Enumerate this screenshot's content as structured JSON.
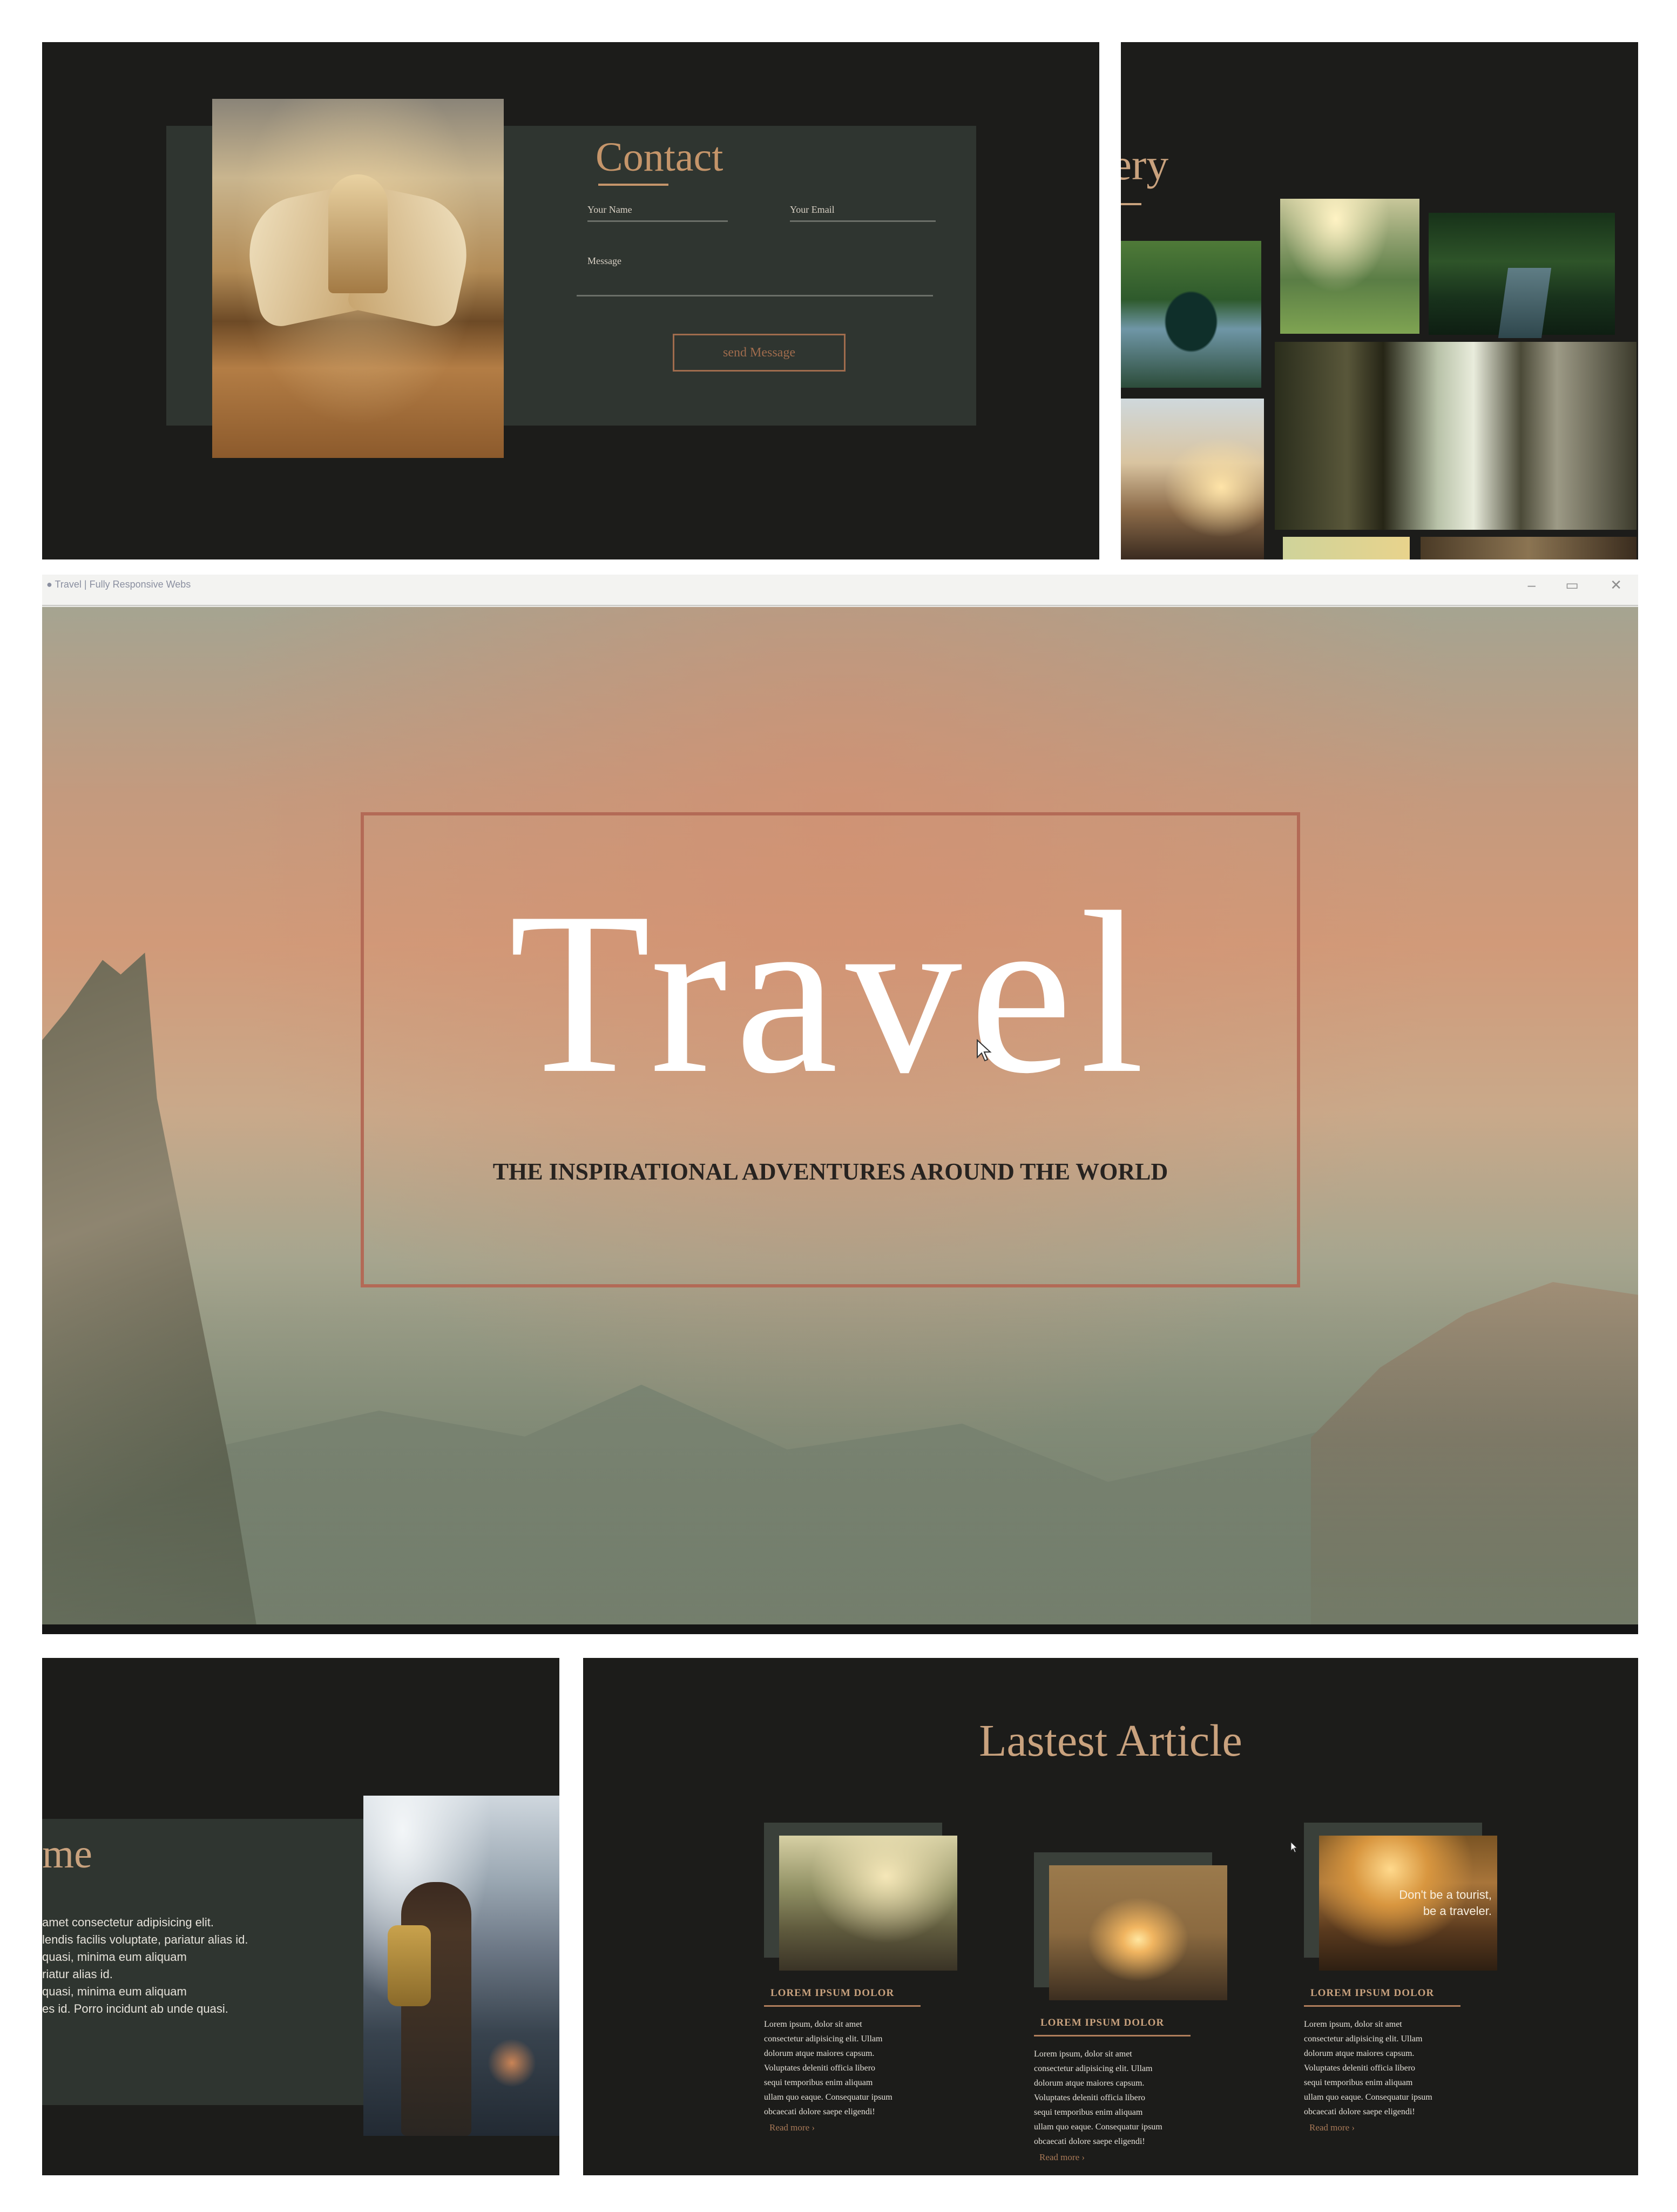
{
  "contact": {
    "title": "Contact",
    "name_label": "Your Name",
    "email_label": "Your Email",
    "message_label": "Message",
    "send_label": "send Message"
  },
  "gallery": {
    "title_fragment": "llery"
  },
  "hero": {
    "browser_tab_text": "● Travel | Fully Responsive Webs",
    "title": "Travel",
    "subtitle": "THE INSPIRATIONAL ADVENTURES AROUND THE WORLD"
  },
  "about": {
    "title_fragment": "me",
    "paragraph": "amet consectetur adipisicing elit.\nlendis facilis voluptate, pariatur alias id.\nquasi, minima eum aliquam\nriatur alias id.\nquasi, minima eum aliquam\nes id. Porro incidunt ab unde quasi."
  },
  "articles": {
    "title": "Lastest Article",
    "cards": [
      {
        "title": "LOREM IPSUM DOLOR",
        "text": "Lorem ipsum, dolor sit amet\nconsectetur adipisicing elit. Ullam\ndolorum atque maiores capsum.\nVoluptates deleniti officia libero\nsequi temporibus enim aliquam\nullam quo eaque. Consequatur ipsum\nobcaecati dolore saepe eligendi!",
        "read_more": "Read more ›"
      },
      {
        "title": "LOREM IPSUM DOLOR",
        "text": "Lorem ipsum, dolor sit amet\nconsectetur adipisicing elit. Ullam\ndolorum atque maiores capsum.\nVoluptates deleniti officia libero\nsequi temporibus enim aliquam\nullam quo eaque. Consequatur ipsum\nobcaecati dolore saepe eligendi!",
        "read_more": "Read more ›"
      },
      {
        "title": "LOREM IPSUM DOLOR",
        "text": "Lorem ipsum, dolor sit amet\nconsectetur adipisicing elit. Ullam\ndolorum atque maiores capsum.\nVoluptates deleniti officia libero\nsequi temporibus enim aliquam\nullam quo eaque. Consequatur ipsum\nobcaecati dolore saepe eligendi!",
        "read_more": "Read more ›",
        "image_quote": "Don't be a tourist,\nbe a traveler."
      }
    ]
  },
  "colors": {
    "background_dark": "#1c1c1a",
    "slab": "#2f3530",
    "accent_gold": "#c9a27e",
    "accent_rust": "#b36a56"
  }
}
